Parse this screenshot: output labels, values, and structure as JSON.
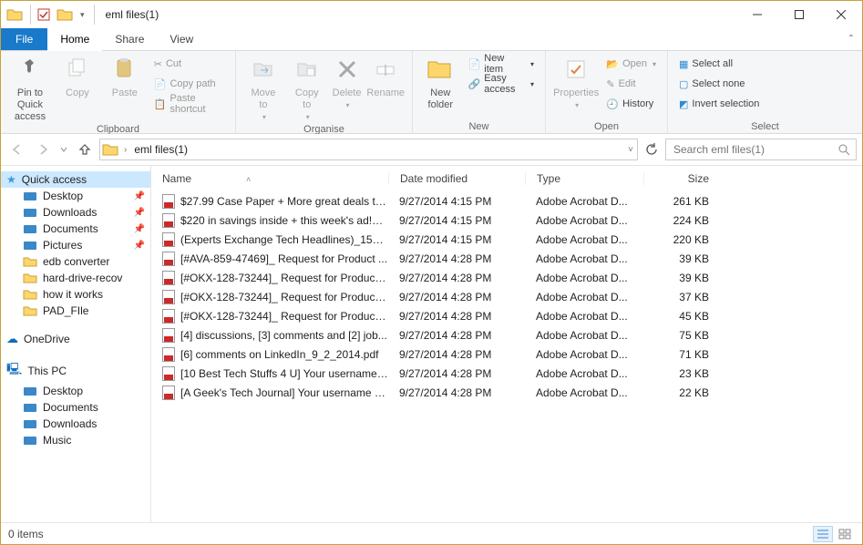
{
  "window": {
    "title": "eml files(1)"
  },
  "tabs": {
    "file": "File",
    "home": "Home",
    "share": "Share",
    "view": "View"
  },
  "ribbon": {
    "pin": "Pin to Quick\naccess",
    "copy": "Copy",
    "paste": "Paste",
    "cut": "Cut",
    "copypath": "Copy path",
    "pasteshortcut": "Paste shortcut",
    "clipboard_group": "Clipboard",
    "moveto": "Move\nto",
    "copyto": "Copy\nto",
    "delete": "Delete",
    "rename": "Rename",
    "organise_group": "Organise",
    "newfolder": "New\nfolder",
    "newitem": "New item",
    "easyaccess": "Easy access",
    "new_group": "New",
    "properties": "Properties",
    "open": "Open",
    "edit": "Edit",
    "history": "History",
    "open_group": "Open",
    "selectall": "Select all",
    "selectnone": "Select none",
    "invert": "Invert selection",
    "select_group": "Select"
  },
  "address": {
    "crumb1": "eml files(1)"
  },
  "search": {
    "placeholder": "Search eml files(1)"
  },
  "sidebar": {
    "quick": "Quick access",
    "quick_items": [
      "Desktop",
      "Downloads",
      "Documents",
      "Pictures",
      "edb converter",
      "hard-drive-recov",
      "how it works",
      "PAD_FIle"
    ],
    "onedrive": "OneDrive",
    "thispc": "This PC",
    "pc_items": [
      "Desktop",
      "Documents",
      "Downloads",
      "Music"
    ]
  },
  "columns": {
    "name": "Name",
    "date": "Date modified",
    "type": "Type",
    "size": "Size"
  },
  "files": [
    {
      "name": "$27.99 Case Paper + More great deals to ...",
      "date": "9/27/2014 4:15 PM",
      "type": "Adobe Acrobat D...",
      "size": "261 KB"
    },
    {
      "name": "$220 in savings inside + this week's ad!_2...",
      "date": "9/27/2014 4:15 PM",
      "type": "Adobe Acrobat D...",
      "size": "224 KB"
    },
    {
      "name": "(Experts Exchange Tech Headlines)_15_11...",
      "date": "9/27/2014 4:15 PM",
      "type": "Adobe Acrobat D...",
      "size": "220 KB"
    },
    {
      "name": "[#AVA-859-47469]_ Request for Product ...",
      "date": "9/27/2014 4:28 PM",
      "type": "Adobe Acrobat D...",
      "size": "39 KB"
    },
    {
      "name": "[#OKX-128-73244]_ Request for Product ...",
      "date": "9/27/2014 4:28 PM",
      "type": "Adobe Acrobat D...",
      "size": "39 KB"
    },
    {
      "name": "[#OKX-128-73244]_ Request for Product ...",
      "date": "9/27/2014 4:28 PM",
      "type": "Adobe Acrobat D...",
      "size": "37 KB"
    },
    {
      "name": "[#OKX-128-73244]_ Request for Product ...",
      "date": "9/27/2014 4:28 PM",
      "type": "Adobe Acrobat D...",
      "size": "45 KB"
    },
    {
      "name": "[4] discussions, [3] comments and [2] job...",
      "date": "9/27/2014 4:28 PM",
      "type": "Adobe Acrobat D...",
      "size": "75 KB"
    },
    {
      "name": "[6] comments on LinkedIn_9_2_2014.pdf",
      "date": "9/27/2014 4:28 PM",
      "type": "Adobe Acrobat D...",
      "size": "71 KB"
    },
    {
      "name": "[10 Best Tech Stuffs 4 U] Your username ...",
      "date": "9/27/2014 4:28 PM",
      "type": "Adobe Acrobat D...",
      "size": "23 KB"
    },
    {
      "name": "[A Geek's Tech Journal] Your username a...",
      "date": "9/27/2014 4:28 PM",
      "type": "Adobe Acrobat D...",
      "size": "22 KB"
    }
  ],
  "status": {
    "count": "0 items"
  }
}
